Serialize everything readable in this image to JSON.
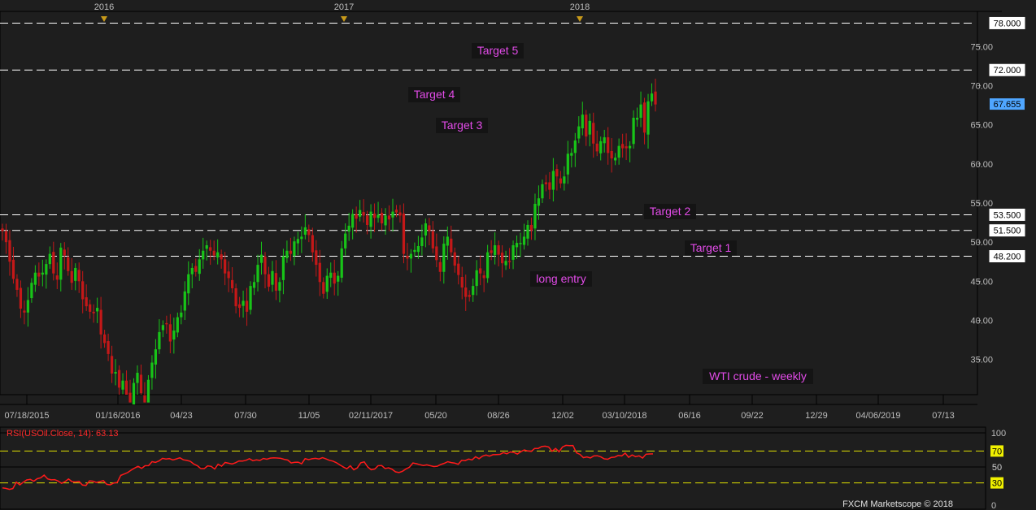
{
  "chart_data": [
    {
      "type": "candlestick",
      "title": "",
      "series_note": "WTI crude - weekly",
      "ylim": [
        30.5,
        79.5
      ],
      "y_ticks": [
        35,
        40,
        45,
        50,
        55,
        60,
        65,
        70,
        75
      ],
      "y_tick_labels": [
        "35.00",
        "40.00",
        "45.00",
        "50.00",
        "55.00",
        "60.00",
        "65.00",
        "70.00",
        "75.00"
      ],
      "x_tick_labels": [
        "07/18/2015",
        "01/16/2016",
        "04/23",
        "07/30",
        "11/05",
        "02/11/2017",
        "05/20",
        "08/26",
        "12/02",
        "03/10/2018",
        "06/16",
        "09/22",
        "12/29",
        "04/06/2019",
        "07/13"
      ],
      "year_markers": [
        "2016",
        "2017",
        "2018"
      ],
      "horizontal_levels": [
        {
          "value": 78.0,
          "label": "78.000"
        },
        {
          "value": 72.0,
          "label": "72.000"
        },
        {
          "value": 53.5,
          "label": "53.500"
        },
        {
          "value": 51.5,
          "label": "51.500"
        },
        {
          "value": 48.2,
          "label": "48.200"
        }
      ],
      "current_price": {
        "value": 67.655,
        "label": "67.655"
      },
      "annotations": [
        "Target 5",
        "Target 4",
        "Target 3",
        "Target 2",
        "Target 1",
        "long entry",
        "WTI crude - weekly"
      ],
      "grid": false,
      "bull_color": "#18c418",
      "bear_color": "#c41818",
      "close": [
        51.4,
        50.0,
        47.5,
        45.3,
        43.9,
        41.5,
        41.0,
        42.6,
        44.8,
        46.1,
        45.6,
        46.1,
        47.2,
        48.5,
        46.0,
        45.2,
        49.3,
        48.3,
        46.3,
        44.8,
        46.7,
        45.0,
        42.7,
        41.8,
        41.1,
        40.9,
        41.6,
        38.2,
        37.1,
        35.7,
        33.2,
        33.4,
        31.4,
        32.3,
        30.5,
        29.5,
        32.0,
        33.3,
        30.7,
        29.5,
        32.4,
        34.6,
        36.3,
        38.5,
        39.4,
        39.5,
        37.3,
        38.7,
        40.4,
        41.0,
        43.7,
        45.9,
        46.7,
        46.2,
        47.8,
        48.9,
        49.6,
        48.9,
        48.3,
        48.7,
        47.8,
        46.0,
        45.4,
        44.1,
        41.8,
        41.6,
        42.5,
        41.1,
        44.4,
        44.9,
        47.1,
        48.4,
        45.9,
        44.3,
        46.3,
        43.8,
        44.9,
        48.2,
        48.9,
        48.5,
        50.1,
        50.4,
        50.7,
        51.9,
        50.9,
        48.7,
        47.1,
        44.9,
        43.4,
        45.7,
        46.1,
        44.7,
        45.7,
        49.2,
        51.1,
        52.1,
        53.6,
        53.0,
        54.1,
        53.4,
        52.2,
        53.9,
        53.1,
        53.5,
        52.4,
        53.4,
        52.9,
        53.9,
        53.8,
        53.4,
        48.5,
        47.9,
        48.5,
        49.0,
        49.5,
        50.6,
        52.4,
        51.4,
        49.2,
        47.7,
        46.2,
        49.8,
        50.7,
        48.7,
        47.0,
        45.8,
        44.2,
        43.0,
        43.0,
        44.4,
        46.4,
        46.0,
        45.4,
        48.7,
        48.6,
        49.6,
        48.4,
        47.3,
        47.6,
        47.5,
        49.6,
        49.9,
        49.9,
        50.7,
        52.2,
        51.5,
        54.9,
        55.6,
        57.4,
        57.4,
        56.7,
        59.1,
        58.4,
        57.5,
        58.4,
        61.3,
        61.4,
        63.0,
        64.8,
        66.3,
        63.5,
        65.5,
        62.6,
        61.6,
        62.9,
        63.4,
        61.4,
        60.7,
        60.8,
        62.3,
        62.0,
        62.0,
        62.3,
        65.9,
        65.9,
        67.6,
        64.0,
        68.0,
        69.0,
        67.6
      ],
      "rsi": {
        "title": "RSI(USOil.Close, 14): 63.13",
        "ylim": [
          0,
          100
        ],
        "levels": [
          {
            "value": 70,
            "label": "70"
          },
          {
            "value": 50,
            "label": "50"
          },
          {
            "value": 30,
            "label": "30"
          }
        ],
        "axis_labels": [
          "100",
          "0"
        ],
        "line_color": "#ff1a1a",
        "values": [
          23.8,
          23.1,
          21.8,
          22.9,
          30.9,
          27.6,
          30.9,
          33.7,
          34.4,
          32.1,
          35.2,
          36.4,
          39.8,
          35.0,
          33.8,
          34.1,
          32.3,
          29.5,
          31.6,
          34.9,
          31.5,
          31.1,
          31.9,
          27.2,
          26.7,
          32.5,
          32.1,
          30.5,
          31.6,
          32.9,
          28.2,
          27.6,
          29.9,
          30.5,
          39.4,
          41.1,
          43.0,
          46.0,
          48.7,
          50.8,
          48.3,
          51.5,
          51.6,
          56.6,
          55.7,
          57.6,
          60.8,
          60.0,
          60.5,
          58.9,
          60.1,
          61.5,
          59.0,
          58.3,
          57.1,
          53.7,
          51.6,
          48.1,
          48.0,
          51.3,
          50.7,
          47.5,
          53.5,
          50.9,
          55.6,
          54.7,
          53.8,
          55.3,
          57.5,
          57.4,
          58.4,
          60.4,
          57.9,
          58.9,
          58.2,
          60.7,
          59.7,
          61.1,
          61.5,
          61.2,
          60.8,
          59.6,
          58.7,
          55.0,
          55.8,
          56.0,
          54.0,
          60.4,
          59.2,
          60.3,
          60.8,
          60.0,
          61.6,
          60.1,
          58.4,
          57.3,
          55.3,
          52.5,
          49.9,
          47.8,
          51.4,
          46.4,
          49.0,
          55.2,
          56.4,
          50.0,
          46.5,
          47.5,
          51.5,
          51.7,
          48.2,
          49.0,
          47.1,
          43.9,
          43.1,
          44.6,
          47.6,
          49.7,
          55.0,
          54.1,
          52.9,
          51.8,
          52.7,
          51.5,
          50.5,
          50.9,
          53.1,
          54.6,
          56.6,
          55.5,
          54.9,
          53.4,
          58.3,
          58.0,
          59.9,
          58.9,
          62.9,
          60.4,
          63.6,
          65.0,
          63.6,
          65.4,
          65.6,
          65.8,
          68.1,
          66.5,
          68.9,
          68.3,
          66.2,
          69.2,
          71.3,
          70.1,
          69.6,
          73.3,
          73.3,
          75.6,
          76.1,
          75.1,
          69.7,
          73.3,
          69.2,
          75.2,
          77.1,
          76.7,
          76.9,
          67.8,
          65.8,
          61.7,
          62.7,
          61.3,
          63.9,
          64.1,
          62.7,
          60.2,
          59.7,
          62.0,
          62.3,
          64.5,
          63.9,
          67.4,
          62.1,
          65.1,
          63.0,
          64.0,
          61.2,
          66.0,
          66.3,
          66.4
        ]
      }
    }
  ],
  "footer": {
    "credit": "FXCM Marketscope © 2018"
  }
}
